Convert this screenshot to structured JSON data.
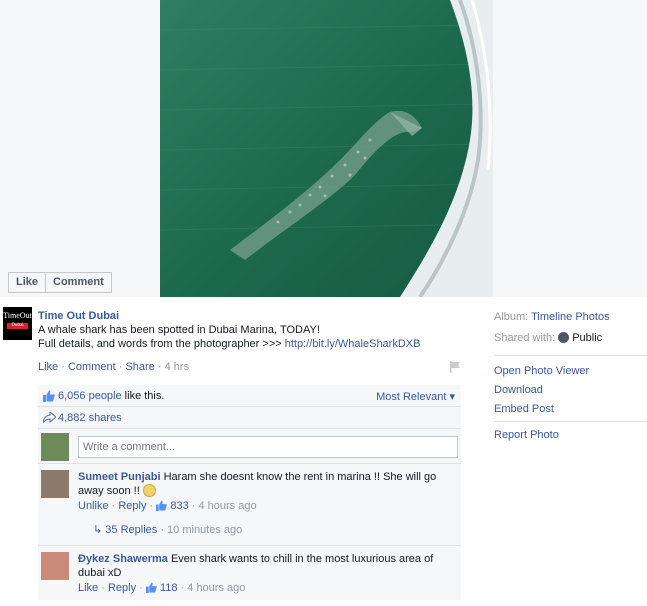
{
  "photo": {
    "like_label": "Like",
    "comment_label": "Comment"
  },
  "post": {
    "poster": "Time Out Dubai",
    "logo_text": "TimeOut",
    "logo_sub": "Dubai",
    "caption_line1": "A whale shark has been spotted in Dubai Marina, TODAY!",
    "caption_line2_prefix": "Full details, and words from the photographer >>> ",
    "caption_link": "http://bit.ly/WhaleSharkDXB",
    "actions": {
      "like": "Like",
      "comment": "Comment",
      "share": "Share",
      "time": "4 hrs",
      "sep": "·"
    }
  },
  "ufi": {
    "likes_count": "6,056 people",
    "likes_suffix": " like this.",
    "most_relevant": "Most Relevant",
    "shares": "4,882 shares",
    "comment_placeholder": "Write a comment..."
  },
  "comments": [
    {
      "author": "Sumeet Punjabi",
      "text": "Haram she doesnt know the rent in marina !! She will go away soon !!",
      "action1": "Unlike",
      "action2": "Reply",
      "likes": "833",
      "time": "4 hours ago",
      "replies": "35 Replies",
      "replies_time": "10 minutes ago"
    },
    {
      "author": "Ðykez Shawerma",
      "text": "Even shark wants to chill in the most luxurious area of dubai xD",
      "action1": "Like",
      "action2": "Reply",
      "likes": "118",
      "time": "4 hours ago"
    }
  ],
  "sidebar": {
    "album_label": "Album:",
    "album_value": "Timeline Photos",
    "shared_label": "Shared with:",
    "shared_value": "Public",
    "options": [
      "Open Photo Viewer",
      "Download",
      "Embed Post"
    ],
    "report": "Report Photo"
  },
  "colors": {
    "link": "#3b5998",
    "water": "#1f6b4f",
    "muted": "#9197a3"
  }
}
